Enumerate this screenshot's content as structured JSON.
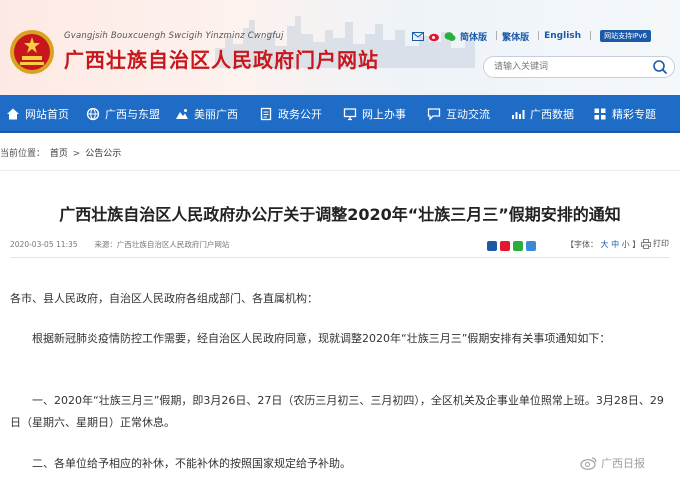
{
  "header": {
    "subtitle": "Gvangjsih Bouxcuengh Swcigih Yinzminz Cwngfuj",
    "title": "广西壮族自治区人民政府门户网站",
    "links": [
      "简体版",
      "繁体版",
      "English"
    ],
    "ipv6_badge": "网站支持IPv6",
    "search_placeholder": "请输入关键词"
  },
  "nav": {
    "items": [
      {
        "label": "网站首页",
        "icon": "home-icon"
      },
      {
        "label": "广西与东盟",
        "icon": "globe-icon"
      },
      {
        "label": "美丽广西",
        "icon": "landscape-icon"
      },
      {
        "label": "政务公开",
        "icon": "document-icon"
      },
      {
        "label": "网上办事",
        "icon": "computer-icon"
      },
      {
        "label": "互动交流",
        "icon": "chat-icon"
      },
      {
        "label": "广西数据",
        "icon": "chart-icon"
      },
      {
        "label": "精彩专题",
        "icon": "grid-icon"
      }
    ]
  },
  "breadcrumb": {
    "prefix": "当前位置：",
    "home": "首页",
    "arrow": ">",
    "section": "公告公示"
  },
  "article": {
    "title": "广西壮族自治区人民政府办公厅关于调整2020年“壮族三月三”假期安排的通知",
    "date": "2020-03-05 11:35",
    "source": "来源：广西壮族自治区人民政府门户网站",
    "font_label": "【字体：",
    "font_options": [
      "大",
      "中",
      "小"
    ],
    "font_close": "】",
    "print_label": "打印",
    "salutation": "各市、县人民政府，自治区人民政府各组成部门、各直属机构：",
    "para1": "根据新冠肺炎疫情防控工作需要，经自治区人民政府同意，现就调整2020年“壮族三月三”假期安排有关事项通知如下：",
    "para2": "一、2020年“壮族三月三”假期，即3月26日、27日（农历三月初三、三月初四），全区机关及企事业单位照常上班。3月28日、29日（星期六、星期日）正常休息。",
    "para3": "二、各单位给予相应的补休，不能补休的按照国家规定给予补助。"
  },
  "watermark": "广西日报",
  "colors": {
    "brand_red": "#c8161d",
    "nav_blue": "#1e6cc6",
    "link_blue": "#1c5aa8"
  }
}
